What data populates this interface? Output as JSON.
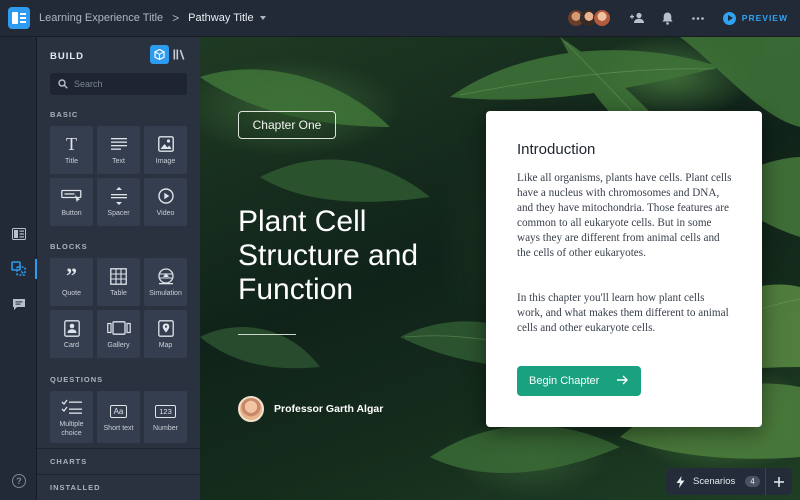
{
  "breadcrumb": {
    "experience": "Learning Experience Title",
    "separator": ">",
    "pathway": "Pathway Title"
  },
  "topbar": {
    "collaborators": [
      "avatar-1",
      "avatar-2",
      "avatar-3"
    ],
    "icons": [
      "add-people-icon",
      "bell-icon",
      "more-icon"
    ],
    "preview_label": "PREVIEW",
    "accent": "#2d9cf0"
  },
  "panel": {
    "title": "BUILD",
    "search_placeholder": "Search",
    "sections": {
      "basic": "BASIC",
      "blocks": "BLOCKS",
      "questions": "QUESTIONS",
      "charts": "CHARTS",
      "installed": "INSTALLED"
    },
    "basic": [
      "Title",
      "Text",
      "Image",
      "Button",
      "Spacer",
      "Video"
    ],
    "blocks": [
      "Quote",
      "Table",
      "Simulation",
      "Card",
      "Gallery",
      "Map"
    ],
    "questions": [
      "Multiple choice",
      "Short text",
      "Number"
    ],
    "question_badges": {
      "short_text": "Aa",
      "number": "123"
    }
  },
  "canvas": {
    "chapter_tag": "Chapter One",
    "title": "Plant Cell Structure and Function",
    "author": "Professor Garth Algar",
    "card": {
      "heading": "Introduction",
      "paragraph1": "Like all organisms, plants have cells. Plant cells have a nucleus with chromosomes and DNA, and they have mitochondria. Those features are common to all eukaryote cells. But in some ways they are different from animal cells and the cells of other eukaryotes.",
      "paragraph2": "In this chapter you'll learn how plant cells work, and what makes them different to animal cells and other eukaryote cells.",
      "button": "Begin Chapter",
      "button_color": "#1aa280"
    }
  },
  "scenarios": {
    "label": "Scenarios",
    "count": "4"
  },
  "help_label": "?"
}
